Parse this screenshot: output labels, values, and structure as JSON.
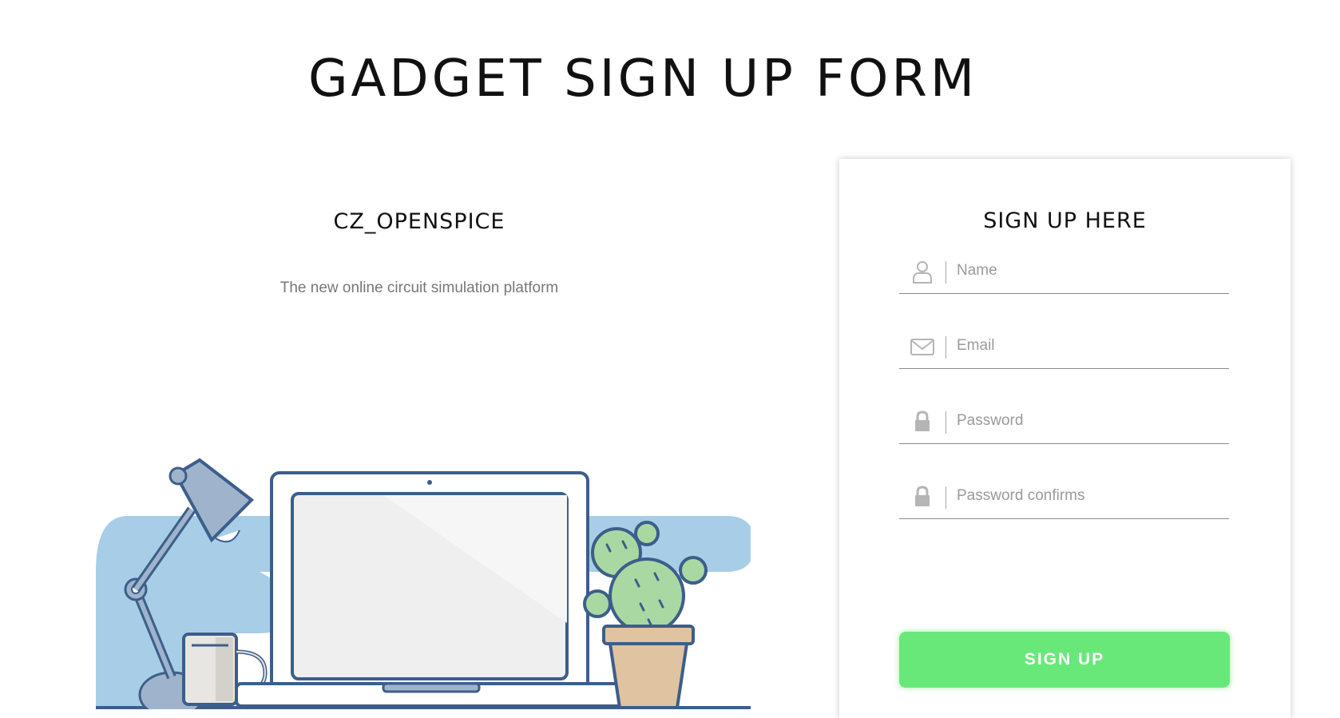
{
  "page": {
    "title": "GADGET SIGN UP FORM"
  },
  "brand": {
    "title": "CZ_OPENSPICE",
    "subtitle": "The new online circuit simulation platform"
  },
  "form": {
    "title": "SIGN UP HERE",
    "fields": [
      {
        "icon": "user-icon",
        "placeholder": "Name",
        "value": ""
      },
      {
        "icon": "envelope-icon",
        "placeholder": "Email",
        "value": ""
      },
      {
        "icon": "lock-icon",
        "placeholder": "Password",
        "value": ""
      },
      {
        "icon": "lock-icon",
        "placeholder": "Password confirms",
        "value": ""
      }
    ],
    "submit_label": "SIGN UP"
  },
  "colors": {
    "accent_green": "#69e87a",
    "illustration_blue": "#a8cde6",
    "outline_blue": "#3c5e8a",
    "cactus_green": "#a9d8a3",
    "pot_tan": "#e0c3a0"
  }
}
